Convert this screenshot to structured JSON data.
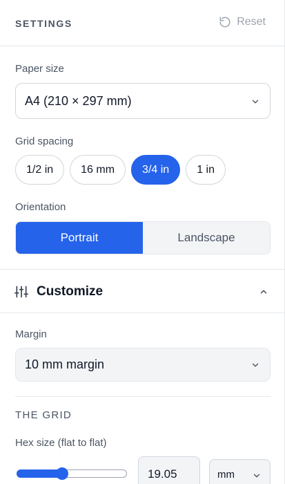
{
  "header": {
    "title": "SETTINGS",
    "reset_label": "Reset"
  },
  "paper": {
    "label": "Paper size",
    "value": "A4 (210 × 297 mm)"
  },
  "grid_spacing": {
    "label": "Grid spacing",
    "options": [
      "1/2 in",
      "16 mm",
      "3/4 in",
      "1 in"
    ],
    "selected": "3/4 in"
  },
  "orientation": {
    "label": "Orientation",
    "options": [
      "Portrait",
      "Landscape"
    ],
    "selected": "Portrait"
  },
  "customize": {
    "title": "Customize",
    "expanded": true
  },
  "margin": {
    "label": "Margin",
    "value": "10 mm margin"
  },
  "grid": {
    "title": "THE GRID",
    "hex_label": "Hex size (flat to flat)",
    "hex_value": "19.05",
    "slider_fraction": 0.41,
    "unit": "mm"
  },
  "colors": {
    "accent": "#2563eb"
  },
  "icons": {
    "reset": "rotate-ccw-icon",
    "chevron": "chevron-down-icon",
    "customize": "sliders-icon",
    "collapse": "chevron-up-icon"
  }
}
